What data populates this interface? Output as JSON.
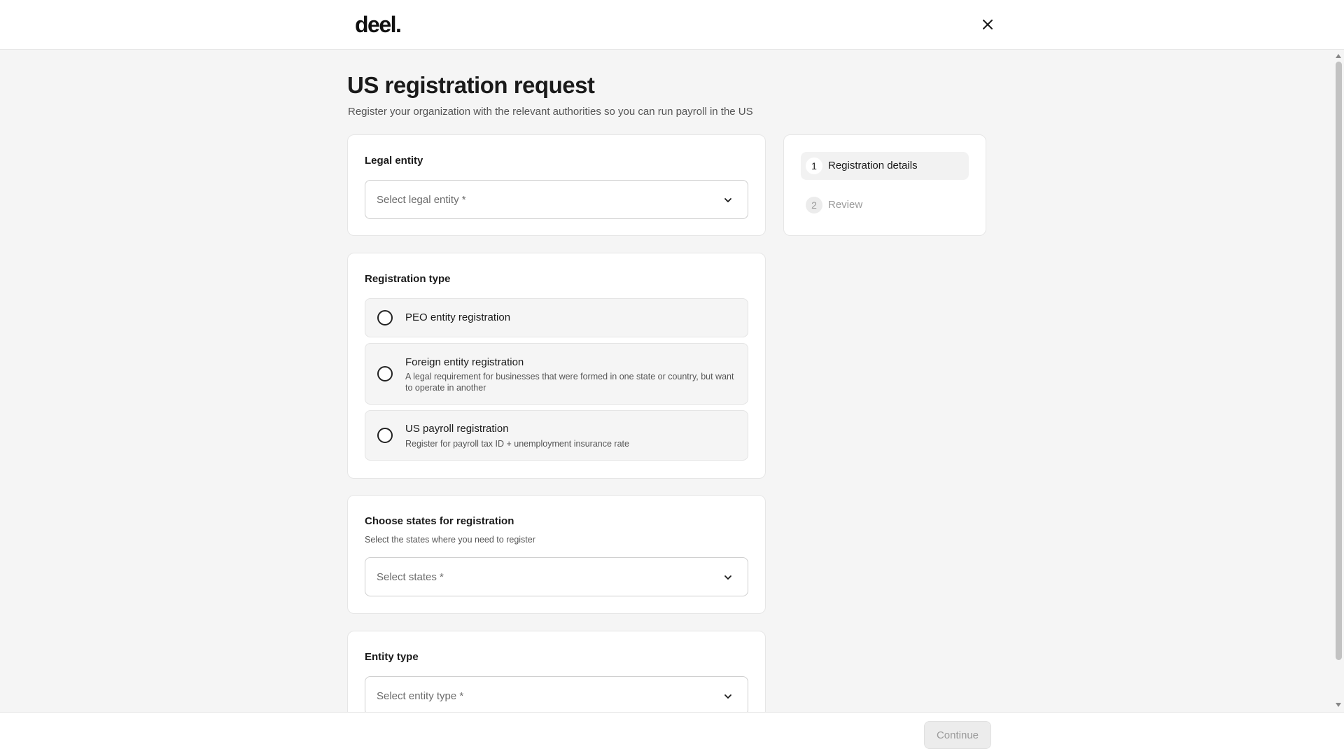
{
  "header": {
    "logo": "deel.",
    "close_icon": "close-icon"
  },
  "page": {
    "title": "US registration request",
    "subtitle": "Register your organization with the relevant authorities so you can run payroll in the US"
  },
  "legal_entity": {
    "title": "Legal entity",
    "placeholder": "Select legal entity *"
  },
  "registration_type": {
    "title": "Registration type",
    "options": [
      {
        "label": "PEO entity registration",
        "description": "",
        "selected": false
      },
      {
        "label": "Foreign entity registration",
        "description": "A legal requirement for businesses that were formed in one state or country, but want to operate in another",
        "selected": false
      },
      {
        "label": "US payroll registration",
        "description": "Register for payroll tax ID + unemployment insurance rate",
        "selected": false
      }
    ]
  },
  "states": {
    "title": "Choose states for registration",
    "subtitle": "Select the states where you need to register",
    "placeholder": "Select states *"
  },
  "entity_type": {
    "title": "Entity type",
    "placeholder": "Select entity type *"
  },
  "steps": [
    {
      "number": "1",
      "label": "Registration details",
      "active": true
    },
    {
      "number": "2",
      "label": "Review",
      "active": false
    }
  ],
  "footer": {
    "continue_label": "Continue",
    "continue_disabled": true
  },
  "colors": {
    "background": "#f5f5f5",
    "card": "#ffffff",
    "text": "#1a1a1a",
    "muted": "#555555",
    "disabled": "#9a9a9a"
  }
}
